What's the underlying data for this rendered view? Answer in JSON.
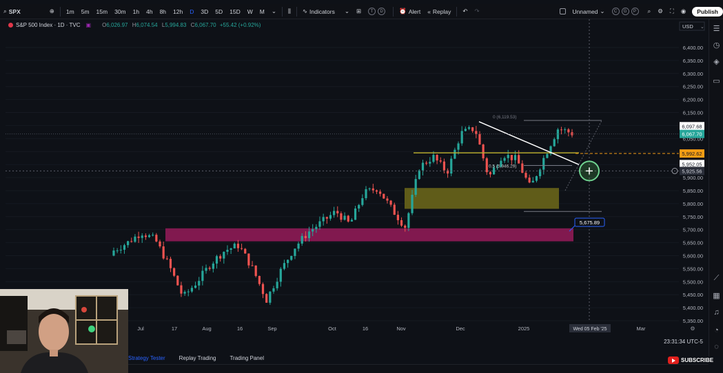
{
  "topbar": {
    "symbol": "SPX",
    "intervals": [
      "1m",
      "5m",
      "15m",
      "30m",
      "1h",
      "4h",
      "8h",
      "12h",
      "D",
      "3D",
      "5D",
      "15D",
      "W",
      "M"
    ],
    "active_interval": "D",
    "indicators_label": "Indicators",
    "alert_label": "Alert",
    "replay_label": "Replay",
    "layout_name": "Unnamed",
    "publish_label": "Publish"
  },
  "legend": {
    "title": "S&P 500 Index · 1D · TVC",
    "open_key": "O",
    "open": "6,026.97",
    "high_key": "H",
    "high": "6,074.54",
    "low_key": "L",
    "low": "5,994.83",
    "close_key": "C",
    "close": "6,067.70",
    "change": "+55.42 (+0.92%)"
  },
  "price_axis": {
    "currency": "USD",
    "ticks": [
      "6,400.00",
      "6,350.00",
      "6,300.00",
      "6,250.00",
      "6,200.00",
      "6,150.00",
      "6,100.00",
      "6,050.00",
      "6,000.00",
      "5,950.00",
      "5,900.00",
      "5,850.00",
      "5,800.00",
      "5,750.00",
      "5,700.00",
      "5,650.00",
      "5,600.00",
      "5,550.00",
      "5,500.00",
      "5,450.00",
      "5,400.00",
      "5,350.00"
    ],
    "labels": [
      {
        "text": "6,097.68",
        "color": "#ffffff",
        "bg": "#ffffff",
        "fg": "#131722"
      },
      {
        "text": "6,067.70",
        "color": "#26a69a",
        "bg": "#26a69a",
        "fg": "#ffffff"
      },
      {
        "text": "5,992.62",
        "color": "#f59d14",
        "bg": "#f59d14",
        "fg": "#131722"
      },
      {
        "text": "5,952.05",
        "color": "#ffffff",
        "bg": "#ffffff",
        "fg": "#131722"
      },
      {
        "text": "5,925.56",
        "color": "#787b86",
        "bg": "#2a2e39",
        "fg": "#d1d4dc"
      }
    ]
  },
  "time_axis": {
    "ticks": [
      "Jul",
      "17",
      "Aug",
      "16",
      "Sep",
      "Oct",
      "16",
      "Nov",
      "Dec",
      "2025",
      "Mar"
    ],
    "crosshair_label": "Wed 05 Feb '25"
  },
  "annotations": {
    "fib_top": "0 (6,119.53)",
    "fib_mid": "0.5 (5,946.29)",
    "target_label": "5,675.89"
  },
  "bottom": {
    "tabs": [
      "Strategy Tester",
      "Replay Trading",
      "Trading Panel"
    ],
    "clock": "23:31:34 UTC-5"
  },
  "overlay": {
    "subscribe_label": "SUBSCRIBE"
  },
  "colors": {
    "up": "#26a69a",
    "down": "#ef5350",
    "zone_magenta": "#8e1b55",
    "zone_olive": "#6f6a1a",
    "fib_line": "#b5a92e",
    "trendline": "#ffffff",
    "orange_dash": "#f59d14"
  },
  "chart_data": {
    "type": "candlestick",
    "ylim": [
      5350,
      6400
    ],
    "candles_ohlc_sample": [
      [
        5600,
        5640,
        5560,
        5620
      ],
      [
        5620,
        5660,
        5590,
        5650
      ],
      [
        5650,
        5700,
        5620,
        5690
      ],
      [
        5690,
        5720,
        5650,
        5660
      ],
      [
        5660,
        5680,
        5540,
        5560
      ],
      [
        5560,
        5600,
        5420,
        5440
      ],
      [
        5440,
        5520,
        5400,
        5500
      ],
      [
        5500,
        5580,
        5480,
        5570
      ],
      [
        5570,
        5630,
        5550,
        5620
      ],
      [
        5620,
        5660,
        5600,
        5640
      ],
      [
        5640,
        5660,
        5530,
        5550
      ],
      [
        5550,
        5600,
        5410,
        5430
      ],
      [
        5430,
        5560,
        5420,
        5540
      ],
      [
        5540,
        5640,
        5530,
        5630
      ],
      [
        5630,
        5700,
        5620,
        5690
      ],
      [
        5690,
        5740,
        5680,
        5730
      ],
      [
        5730,
        5780,
        5720,
        5770
      ],
      [
        5770,
        5800,
        5700,
        5720
      ],
      [
        5720,
        5850,
        5710,
        5840
      ],
      [
        5840,
        5880,
        5820,
        5860
      ],
      [
        5860,
        5870,
        5760,
        5780
      ],
      [
        5780,
        5830,
        5700,
        5710
      ],
      [
        5710,
        5960,
        5700,
        5940
      ],
      [
        5940,
        5990,
        5920,
        5980
      ],
      [
        5980,
        6010,
        5900,
        5920
      ],
      [
        5920,
        6080,
        5910,
        6070
      ],
      [
        6070,
        6110,
        6040,
        6090
      ],
      [
        6090,
        6100,
        5880,
        5900
      ],
      [
        5900,
        6000,
        5870,
        5990
      ],
      [
        5990,
        6050,
        5960,
        5970
      ],
      [
        5970,
        6000,
        5840,
        5860
      ],
      [
        5860,
        5990,
        5850,
        5980
      ],
      [
        5980,
        6100,
        5970,
        6090
      ],
      [
        6090,
        6130,
        6050,
        6070
      ]
    ]
  }
}
